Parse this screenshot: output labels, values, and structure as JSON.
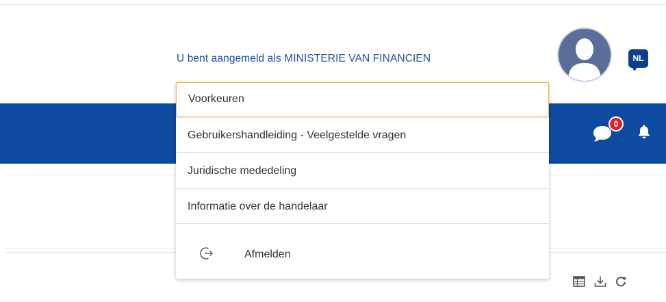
{
  "header": {
    "login_status": "U bent aangemeld als MINISTERIE VAN FINANCIEN",
    "language_code": "NL"
  },
  "notifications": {
    "message_count": "0"
  },
  "user_menu": {
    "items": [
      {
        "label": "Voorkeuren"
      },
      {
        "label": "Gebruikershandleiding - Veelgestelde vragen"
      },
      {
        "label": "Juridische mededeling"
      },
      {
        "label": "Informatie over de handelaar"
      }
    ],
    "logout_label": "Afmelden"
  },
  "colors": {
    "nav_bar": "#0e4aa0",
    "link_text": "#1f4e9c",
    "badge": "#e02424",
    "focus_outline": "#f0b43c"
  },
  "icons": [
    "avatar-icon",
    "language-icon",
    "chat-icon",
    "bell-icon",
    "logout-icon",
    "table-icon",
    "download-icon",
    "refresh-icon"
  ]
}
